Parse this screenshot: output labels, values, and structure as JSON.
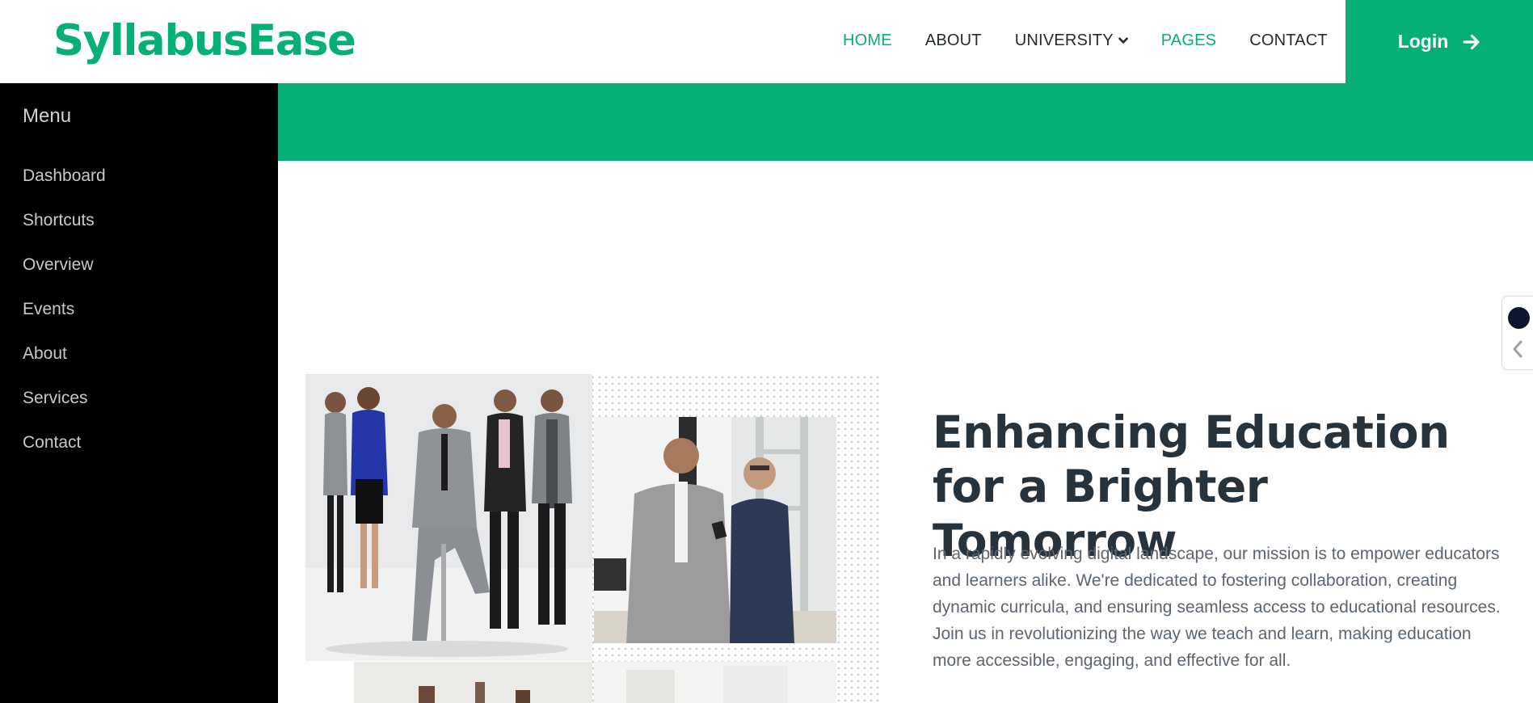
{
  "header": {
    "logo": "SyllabusEase",
    "nav": [
      {
        "label": "HOME",
        "active": true
      },
      {
        "label": "ABOUT",
        "active": false
      },
      {
        "label": "UNIVERSITY",
        "active": false,
        "dropdown": true
      },
      {
        "label": "PAGES",
        "active": true
      },
      {
        "label": "CONTACT",
        "active": false
      }
    ],
    "login_label": "Login",
    "login_icon": "arrow-right-icon"
  },
  "sidebar": {
    "title": "Menu",
    "items": [
      {
        "label": "Dashboard"
      },
      {
        "label": "Shortcuts"
      },
      {
        "label": "Overview"
      },
      {
        "label": "Events"
      },
      {
        "label": "About"
      },
      {
        "label": "Services"
      },
      {
        "label": "Contact"
      }
    ]
  },
  "hero": {
    "title": "Enhancing Education for a Brighter Tomorrow",
    "text": "In a rapidly evolving digital landscape, our mission is to empower educators and learners alike. We're dedicated to fostering collaboration, creating dynamic curricula, and ensuring seamless access to educational resources. Join us in revolutionizing the way we teach and learn, making education more accessible, engaging, and effective for all."
  },
  "colors": {
    "brand": "#06b075",
    "sidebar_bg": "#000000",
    "heading": "#26323c",
    "body_text": "#5c6670"
  }
}
